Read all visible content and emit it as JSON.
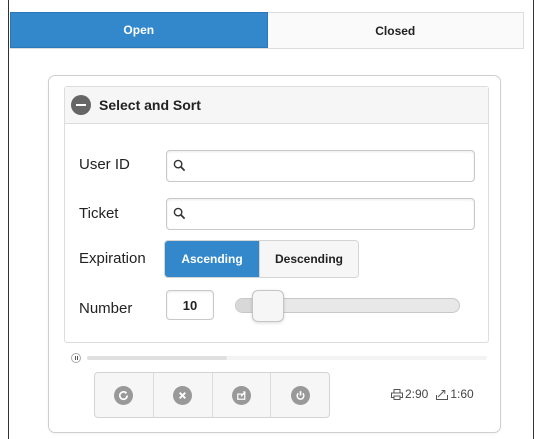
{
  "tabs": [
    {
      "label": "Open",
      "active": true
    },
    {
      "label": "Closed",
      "active": false
    }
  ],
  "panel": {
    "title": "Select and Sort",
    "user_id": {
      "label": "User ID",
      "value": ""
    },
    "ticket": {
      "label": "Ticket",
      "value": ""
    },
    "expiration": {
      "label": "Expiration",
      "options": [
        "Ascending",
        "Descending"
      ],
      "selected": "Ascending"
    },
    "number": {
      "label": "Number",
      "value": "10",
      "slider_fraction": 0.1
    }
  },
  "progress": {
    "fraction": 0.35
  },
  "toolbar": {
    "icons": [
      "refresh-icon",
      "close-icon",
      "export-icon",
      "power-icon"
    ]
  },
  "stats": {
    "printed": "2:90",
    "uploaded": "1:60"
  },
  "colors": {
    "accent": "#3388cc",
    "icon_gray": "#999999"
  }
}
